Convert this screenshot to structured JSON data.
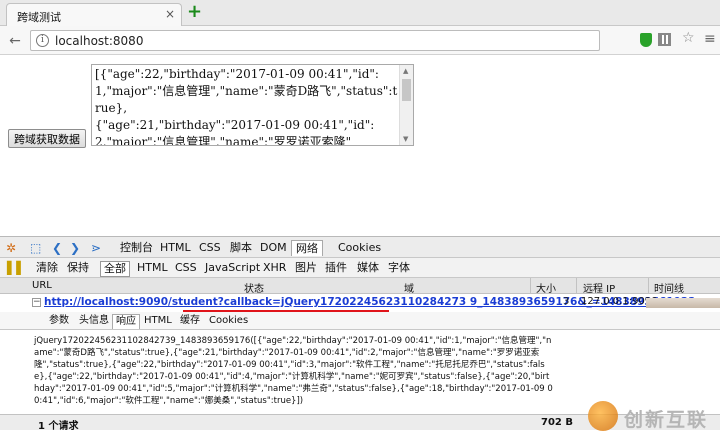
{
  "browser": {
    "tab_title": "跨域测试",
    "tab_close": "×",
    "new_tab": "+",
    "url": "localhost:8080",
    "info_glyph": "i",
    "star_glyph": "☆",
    "menu_glyph": "≡"
  },
  "page": {
    "button_label": "跨域获取数据",
    "response_text": "[{\"age\":22,\"birthday\":\"2017-01-09 00:41\",\"id\":1,\"major\":\"信息管理\",\"name\":\"蒙奇D路飞\",\"status\":true},\n{\"age\":21,\"birthday\":\"2017-01-09 00:41\",\"id\":2,\"major\":\"信息管理\",\"name\":\"罗罗诺亚索隆\""
  },
  "firebug": {
    "main_tabs": [
      "控制台",
      "HTML",
      "CSS",
      "脚本",
      "DOM",
      "网络",
      "Cookies"
    ],
    "active_main_tab": "网络",
    "filters": [
      "清除",
      "保持",
      "全部",
      "HTML",
      "CSS",
      "JavaScript",
      "XHR",
      "图片",
      "插件",
      "媒体",
      "字体"
    ],
    "columns": [
      "URL",
      "状态",
      "域",
      "大小",
      "远程 IP",
      "时间线"
    ],
    "request": {
      "url": "http://localhost:9090/student?callback=jQuery17202245623110284273 9_1483893659176&_=1483893661922",
      "status": "3",
      "remote_ip": "127.0.0.1:9090"
    },
    "sub_tabs": [
      "参数",
      "头信息",
      "响应",
      "HTML",
      "缓存",
      "Cookies"
    ],
    "active_sub_tab": "响应",
    "response_body": "jQuery172022456231102842739_1483893659176([{\"age\":22,\"birthday\":\"2017-01-09 00:41\",\"id\":1,\"major\":\"信息管理\",\"name\":\"蒙奇D路飞\",\"status\":true},{\"age\":21,\"birthday\":\"2017-01-09 00:41\",\"id\":2,\"major\":\"信息管理\",\"name\":\"罗罗诺亚索隆\",\"status\":true},{\"age\":22,\"birthday\":\"2017-01-09 00:41\",\"id\":3,\"major\":\"软件工程\",\"name\":\"托尼托尼乔巴\",\"status\":false},{\"age\":22,\"birthday\":\"2017-01-09 00:41\",\"id\":4,\"major\":\"计算机科学\",\"name\":\"妮可罗宾\",\"status\":false},{\"age\":20,\"birthday\":\"2017-01-09 00:41\",\"id\":5,\"major\":\"计算机科学\",\"name\":\"弗兰奇\",\"status\":false},{\"age\":18,\"birthday\":\"2017-01-09 00:41\",\"id\":6,\"major\":\"软件工程\",\"name\":\"娜美桑\",\"status\":true}])",
    "request_count": "1 个请求",
    "total_size": "702 B"
  },
  "watermark": {
    "text": "创新互联"
  },
  "colors": {
    "link_blue": "#1a3cd4",
    "underline_red": "#e0141a",
    "new_tab_green": "#1a8a1a"
  }
}
